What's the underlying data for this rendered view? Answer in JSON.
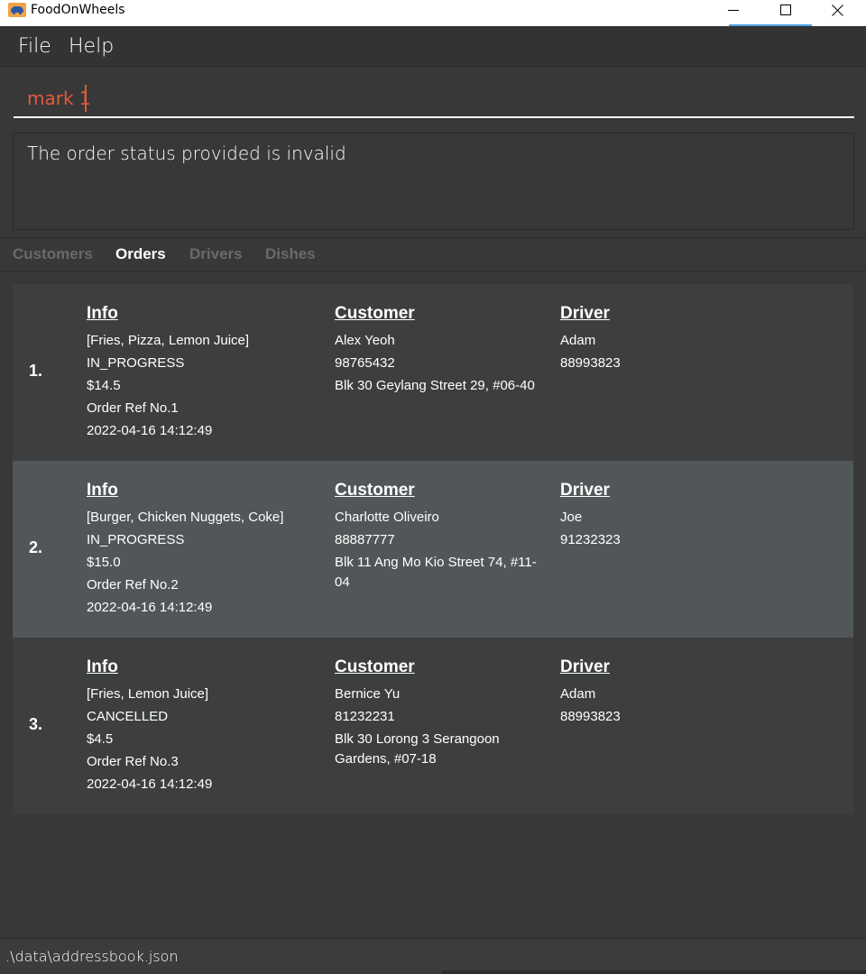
{
  "window": {
    "title": "FoodOnWheels"
  },
  "menu": {
    "file": "File",
    "help": "Help"
  },
  "command": {
    "value": "mark 1"
  },
  "result": {
    "message": "The order status provided is invalid"
  },
  "tabs": [
    {
      "label": "Customers"
    },
    {
      "label": "Orders"
    },
    {
      "label": "Drivers"
    },
    {
      "label": "Dishes"
    }
  ],
  "headers": {
    "info": "Info",
    "customer": "Customer",
    "driver": "Driver"
  },
  "orders": [
    {
      "index": "1.",
      "dishes": "[Fries, Pizza, Lemon Juice]",
      "status": "IN_PROGRESS",
      "price": "$14.5",
      "ref": "Order Ref No.1",
      "time": "2022-04-16 14:12:49",
      "customer_name": "Alex Yeoh",
      "customer_phone": "98765432",
      "customer_address": "Blk 30 Geylang Street 29, #06-40",
      "driver_name": "Adam",
      "driver_phone": "88993823"
    },
    {
      "index": "2.",
      "dishes": "[Burger, Chicken Nuggets, Coke]",
      "status": "IN_PROGRESS",
      "price": "$15.0",
      "ref": "Order Ref No.2",
      "time": "2022-04-16 14:12:49",
      "customer_name": "Charlotte Oliveiro",
      "customer_phone": "88887777",
      "customer_address": "Blk 11 Ang Mo Kio Street 74, #11-04",
      "driver_name": "Joe",
      "driver_phone": "91232323"
    },
    {
      "index": "3.",
      "dishes": "[Fries, Lemon Juice]",
      "status": "CANCELLED",
      "price": "$4.5",
      "ref": "Order Ref No.3",
      "time": "2022-04-16 14:12:49",
      "customer_name": "Bernice Yu",
      "customer_phone": "81232231",
      "customer_address": "Blk 30 Lorong 3 Serangoon Gardens, #07-18",
      "driver_name": "Adam",
      "driver_phone": "88993823"
    }
  ],
  "status_bar": {
    "path": ".\\data\\addressbook.json"
  },
  "colors": {
    "command_text": "#e25a3e",
    "background": "#383838",
    "selected_card": "#515658"
  }
}
